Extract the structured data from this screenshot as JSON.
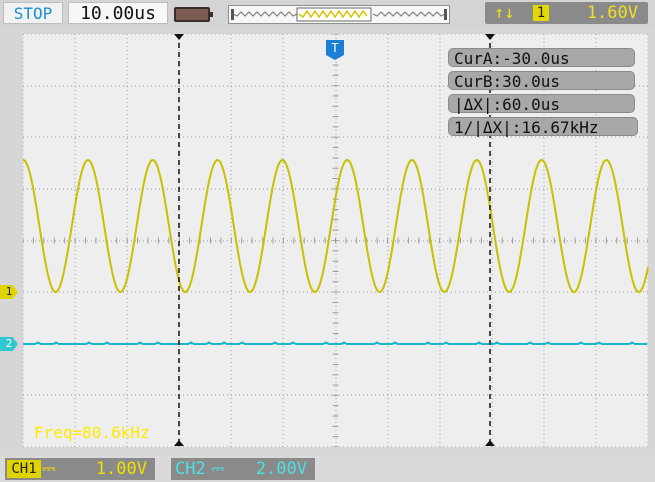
{
  "topbar": {
    "status": "STOP",
    "timebase": "10.00us",
    "trigger_edge_symbol": "↑↓",
    "trigger_channel": "1",
    "trigger_level": "1.60V"
  },
  "cursors": {
    "cur_a": "CurA:-30.0us",
    "cur_b": "CurB:30.0us",
    "delta_x": "|ΔX|:60.0us",
    "inv_delta_x": "1/|ΔX|:16.67kHz"
  },
  "measure": {
    "freq": "Freq=80.6kHz"
  },
  "markers": {
    "ch1": "1",
    "ch2": "2",
    "trigger": "T"
  },
  "bottombar": {
    "ch1_tag": "CH1",
    "ch1_coupling": "⎓",
    "ch1_scale": "1.00V",
    "ch2_tag": "CH2",
    "ch2_coupling": "⎓",
    "ch2_scale": "2.00V"
  },
  "colors": {
    "ch1": "#c9c000",
    "ch2": "#18b8c8",
    "cursor": "#111111",
    "status": "#1a8fd0",
    "trigger": "#f0e020"
  },
  "icons": {
    "battery": "battery-icon",
    "memory": "memory-depth-icon",
    "trigger_edge": "trigger-edge-icon"
  }
}
